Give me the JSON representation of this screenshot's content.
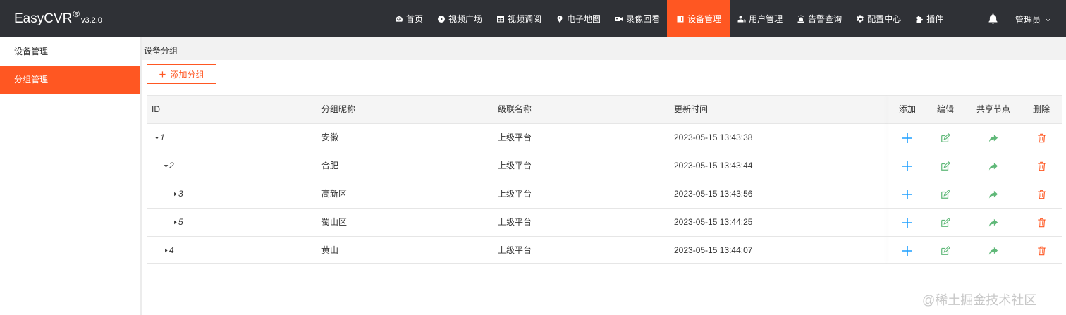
{
  "app": {
    "name": "EasyCVR",
    "reg": "®",
    "version": "v3.2.0"
  },
  "nav": [
    {
      "label": "首页",
      "icon": "dashboard-icon"
    },
    {
      "label": "视频广场",
      "icon": "play-icon"
    },
    {
      "label": "视频调阅",
      "icon": "grid-icon"
    },
    {
      "label": "电子地图",
      "icon": "map-pin-icon"
    },
    {
      "label": "录像回看",
      "icon": "video-camera-icon"
    },
    {
      "label": "设备管理",
      "icon": "device-icon",
      "active": true
    },
    {
      "label": "用户管理",
      "icon": "users-icon"
    },
    {
      "label": "告警查询",
      "icon": "alarm-icon"
    },
    {
      "label": "配置中心",
      "icon": "gear-icon"
    },
    {
      "label": "插件",
      "icon": "puzzle-icon"
    }
  ],
  "user": {
    "name": "管理员"
  },
  "sidebar": {
    "items": [
      {
        "label": "设备管理"
      },
      {
        "label": "分组管理",
        "active": true
      }
    ]
  },
  "breadcrumb": "设备分组",
  "add_group_label": "添加分组",
  "table": {
    "headers": {
      "id": "ID",
      "name": "分组昵称",
      "cascade": "级联名称",
      "updated": "更新时间",
      "add": "添加",
      "edit": "编辑",
      "share": "共享节点",
      "delete": "删除"
    },
    "rows": [
      {
        "id": "1",
        "name": "安徽",
        "cascade": "上级平台",
        "updated": "2023-05-15 13:43:38",
        "level": 0,
        "expanded": true
      },
      {
        "id": "2",
        "name": "合肥",
        "cascade": "上级平台",
        "updated": "2023-05-15 13:43:44",
        "level": 1,
        "expanded": true
      },
      {
        "id": "3",
        "name": "高新区",
        "cascade": "上级平台",
        "updated": "2023-05-15 13:43:56",
        "level": 2,
        "expanded": false
      },
      {
        "id": "5",
        "name": "蜀山区",
        "cascade": "上级平台",
        "updated": "2023-05-15 13:44:25",
        "level": 2,
        "expanded": false
      },
      {
        "id": "4",
        "name": "黄山",
        "cascade": "上级平台",
        "updated": "2023-05-15 13:44:07",
        "level": 1,
        "expanded": false
      }
    ]
  },
  "colors": {
    "accent": "#ff5722",
    "topbar": "#2f3136",
    "add": "#1e9fff",
    "edit": "#5fb878",
    "share": "#5fb878",
    "delete": "#ff5722"
  },
  "watermark": "@稀土掘金技术社区"
}
